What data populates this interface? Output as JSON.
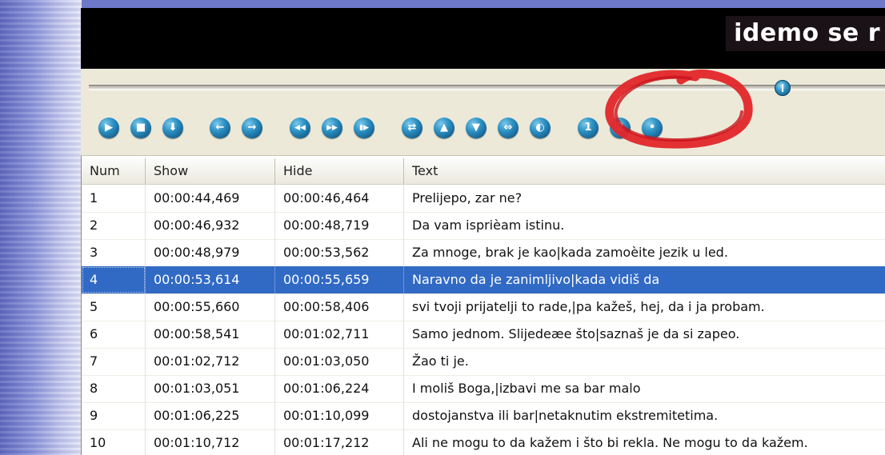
{
  "video": {
    "subtitle_preview": "idemo se r"
  },
  "seek": {
    "position": 0.87
  },
  "toolbar": {
    "buttons": [
      {
        "name": "play-button-icon",
        "glyph": "▶"
      },
      {
        "name": "stop-button-icon",
        "glyph": "■"
      },
      {
        "name": "download-button-icon",
        "glyph": "⬇"
      },
      {
        "name": "back-button-icon",
        "glyph": "←"
      },
      {
        "name": "forward-button-icon",
        "glyph": "→"
      },
      {
        "name": "rewind-button-icon",
        "glyph": "◀◀"
      },
      {
        "name": "fast-forward-button-icon",
        "glyph": "▶▶"
      },
      {
        "name": "step-frame-button-icon",
        "glyph": "▮▶"
      },
      {
        "name": "swap-button-icon",
        "glyph": "⇄"
      },
      {
        "name": "move-up-button-icon",
        "glyph": "▲"
      },
      {
        "name": "move-down-button-icon",
        "glyph": "▼"
      },
      {
        "name": "shift-button-icon",
        "glyph": "⇔"
      },
      {
        "name": "partial-button-icon",
        "glyph": "◐"
      },
      {
        "name": "mark-one-button-icon",
        "glyph": "1"
      },
      {
        "name": "mark-two-button-icon",
        "glyph": "2"
      },
      {
        "name": "extra-button-icon",
        "glyph": "•"
      }
    ],
    "annotation_color": "#e3262a"
  },
  "table": {
    "headers": {
      "num": "Num",
      "show": "Show",
      "hide": "Hide",
      "text": "Text"
    },
    "rows": [
      {
        "num": "1",
        "show": "00:00:44,469",
        "hide": "00:00:46,464",
        "text": "Prelijepo, zar ne?"
      },
      {
        "num": "2",
        "show": "00:00:46,932",
        "hide": "00:00:48,719",
        "text": "Da vam isprièam istinu."
      },
      {
        "num": "3",
        "show": "00:00:48,979",
        "hide": "00:00:53,562",
        "text": "Za mnoge, brak je kao|kada zamoèite jezik u led."
      },
      {
        "num": "4",
        "show": "00:00:53,614",
        "hide": "00:00:55,659",
        "text": "Naravno da je zanimljivo|kada vidiš da"
      },
      {
        "num": "5",
        "show": "00:00:55,660",
        "hide": "00:00:58,406",
        "text": "svi tvoji prijatelji to rade,|pa kažeš, hej, da i ja probam."
      },
      {
        "num": "6",
        "show": "00:00:58,541",
        "hide": "00:01:02,711",
        "text": "Samo jednom. Slijedeæe što|saznaš je da si zapeo."
      },
      {
        "num": "7",
        "show": "00:01:02,712",
        "hide": "00:01:03,050",
        "text": "Žao ti je."
      },
      {
        "num": "8",
        "show": "00:01:03,051",
        "hide": "00:01:06,224",
        "text": "I moliš Boga,|izbavi me sa bar malo"
      },
      {
        "num": "9",
        "show": "00:01:06,225",
        "hide": "00:01:10,099",
        "text": "dostojanstva ili bar|netaknutim ekstremitetima."
      },
      {
        "num": "10",
        "show": "00:01:10,712",
        "hide": "00:01:17,212",
        "text": "Ali ne mogu to da kažem i što bi rekla. Ne mogu to da kažem."
      }
    ],
    "selected_row": "4",
    "selection_color": "#316ac5"
  }
}
